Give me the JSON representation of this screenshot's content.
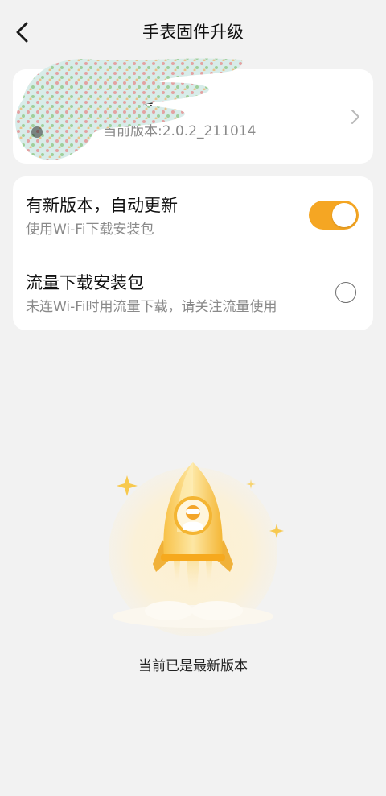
{
  "header": {
    "title": "手表固件升级"
  },
  "device": {
    "name": "的手表",
    "version_label": "当前版本:",
    "version_value": "2.0.2_211014"
  },
  "settings": {
    "auto_update": {
      "title": "有新版本，自动更新",
      "subtitle": "使用Wi-Fi下载安装包",
      "enabled": true
    },
    "cellular_download": {
      "title": "流量下载安装包",
      "subtitle": "未连Wi-Fi时用流量下载，请关注流量使用",
      "enabled": false
    }
  },
  "status": {
    "message": "当前已是最新版本"
  },
  "colors": {
    "accent": "#f5a623",
    "background": "#f2f2f2",
    "card": "#ffffff"
  },
  "icons": {
    "back": "chevron-left-icon",
    "detail": "chevron-right-icon",
    "illustration": "rocket-illustration"
  }
}
